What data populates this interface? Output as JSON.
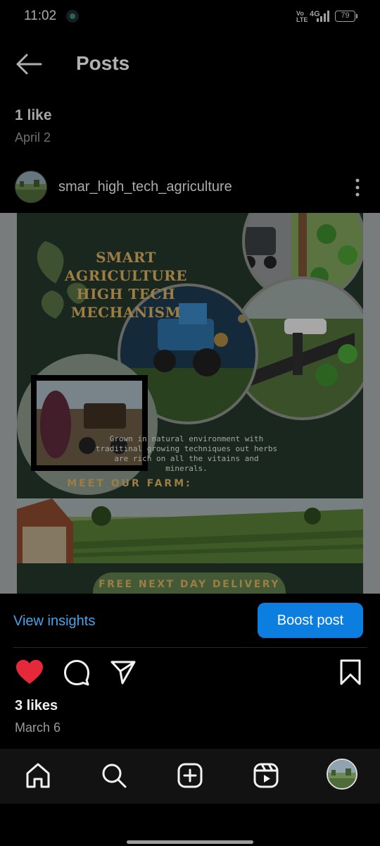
{
  "status_bar": {
    "time": "11:02",
    "volte": "Vo\nLTE",
    "network": "4G",
    "battery": "79"
  },
  "header": {
    "title": "Posts"
  },
  "previous_post": {
    "likes": "1 like",
    "date": "April 2"
  },
  "post": {
    "username": "smar_high_tech_agriculture",
    "image": {
      "title": "SMART AGRICULTURE HIGH TECH MECHANISM",
      "description": "Grown in natural environment with traditinal growing techniques out herbs are rich on all the vitains and minerals.",
      "meet": "MEET OUR FARM:",
      "delivery": "FREE NEXT DAY DELIVERY"
    },
    "insights_label": "View insights",
    "boost_label": "Boost post",
    "likes": "3 likes",
    "date": "March 6",
    "liked": true
  },
  "colors": {
    "accent_blue": "#0b7ee0",
    "link_blue": "#4aa3e8",
    "like_red": "#e5293a",
    "poster_green": "#24362b",
    "poster_gold": "#d8ad5e"
  },
  "icons": {
    "header": [
      "back-arrow-icon",
      "more-options-icon"
    ],
    "post_actions": [
      "heart-icon",
      "comment-icon",
      "share-icon",
      "bookmark-icon"
    ],
    "nav": [
      "home-icon",
      "search-icon",
      "create-icon",
      "reels-icon",
      "profile-avatar"
    ]
  }
}
